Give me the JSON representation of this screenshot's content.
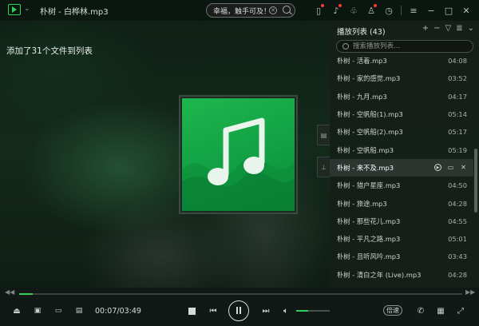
{
  "window": {
    "title": "朴树 - 白桦林.mp3",
    "search_text": "幸福，触手可及！"
  },
  "toast": "添加了31个文件到列表",
  "playlist": {
    "title": "播放列表 (43)",
    "search_placeholder": "搜索播放列表...",
    "items": [
      {
        "name": "朴树 - 活着.mp3",
        "duration": "04:08"
      },
      {
        "name": "朴树 - 家的感觉.mp3",
        "duration": "03:52"
      },
      {
        "name": "朴树 - 九月.mp3",
        "duration": "04:17"
      },
      {
        "name": "朴树 - 空帆船(1).mp3",
        "duration": "05:14"
      },
      {
        "name": "朴树 - 空帆船(2).mp3",
        "duration": "05:17"
      },
      {
        "name": "朴树 - 空帆船.mp3",
        "duration": "05:19"
      },
      {
        "name": "朴树 - 来不及.mp3",
        "duration": ""
      },
      {
        "name": "朴树 - 猎户星座.mp3",
        "duration": "04:50"
      },
      {
        "name": "朴树 - 旅途.mp3",
        "duration": "04:28"
      },
      {
        "name": "朴树 - 那些花儿.mp3",
        "duration": "04:55"
      },
      {
        "name": "朴树 - 平凡之路.mp3",
        "duration": "05:01"
      },
      {
        "name": "朴树 - 且听风吟.mp3",
        "duration": "03:43"
      },
      {
        "name": "朴树 - 清白之年 (Live).mp3",
        "duration": "04:28"
      }
    ],
    "active_index": 6
  },
  "player": {
    "time": "00:07/03:49",
    "progress": 0.03,
    "volume": 0.35,
    "speed_label": "倍速"
  },
  "colors": {
    "accent": "#2fd05a",
    "cover_green": "#12a444"
  }
}
